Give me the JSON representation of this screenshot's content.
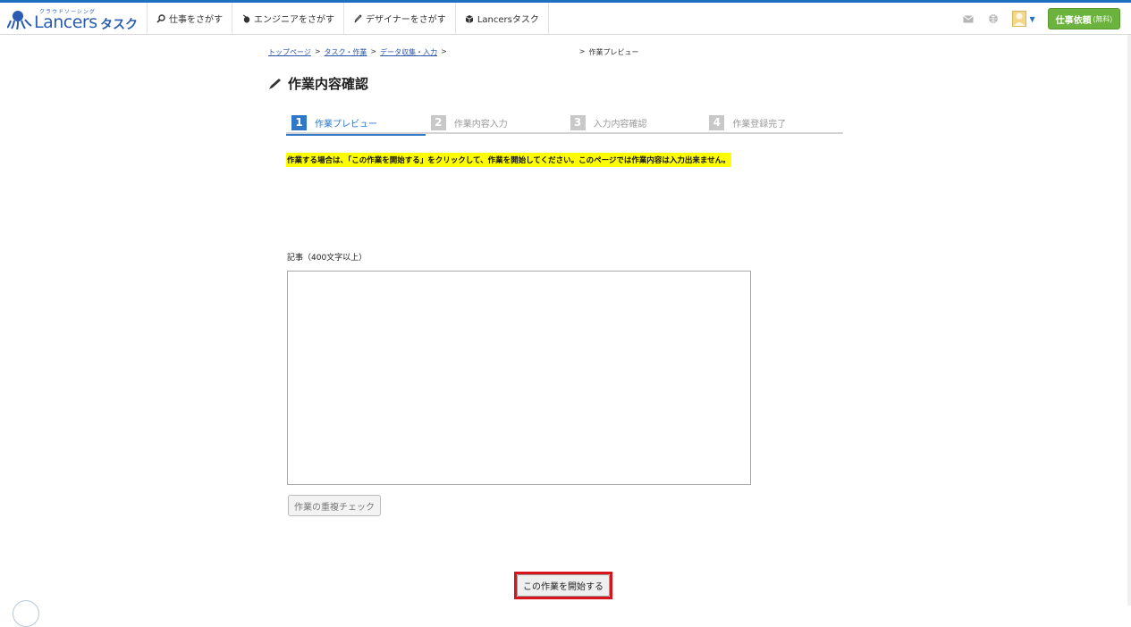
{
  "header": {
    "logo": {
      "kana": "クラウドソーシング",
      "word": "Lancers",
      "task": "タスク"
    },
    "nav": [
      {
        "label": "仕事をさがす",
        "icon": "search-icon"
      },
      {
        "label": "エンジニアをさがす",
        "icon": "mouse-icon"
      },
      {
        "label": "デザイナーをさがす",
        "icon": "pen-icon"
      },
      {
        "label": "Lancersタスク",
        "icon": "box-icon"
      }
    ],
    "right": {
      "icons": [
        "mail-icon",
        "globe-icon",
        "avatar",
        "chevron-down-icon"
      ],
      "cta_label": "仕事依頼",
      "cta_sub": "(無料)"
    }
  },
  "breadcrumb": {
    "items": [
      "トップページ",
      "タスク・作業",
      "データ収集・入力"
    ],
    "separator": ">",
    "current": "作業プレビュー"
  },
  "page_title": "作業内容確認",
  "steps": [
    {
      "num": "1",
      "label": "作業プレビュー",
      "active": true
    },
    {
      "num": "2",
      "label": "作業内容入力",
      "active": false
    },
    {
      "num": "3",
      "label": "入力内容確認",
      "active": false
    },
    {
      "num": "4",
      "label": "作業登録完了",
      "active": false
    }
  ],
  "notice": "作業する場合は、「この作業を開始する」をクリックして、作業を開始してください。このページでは作業内容は入力出来ません。",
  "form": {
    "article_label": "記事（400文字以上）",
    "article_value": "",
    "dup_check_label": "作業の重複チェック"
  },
  "start_button": "この作業を開始する",
  "colors": {
    "brand_blue": "#2a5db0",
    "step_active": "#2f78c8",
    "cta_green": "#6cb33e",
    "notice_bg": "#fefe00",
    "highlight_red": "#d9141c"
  }
}
